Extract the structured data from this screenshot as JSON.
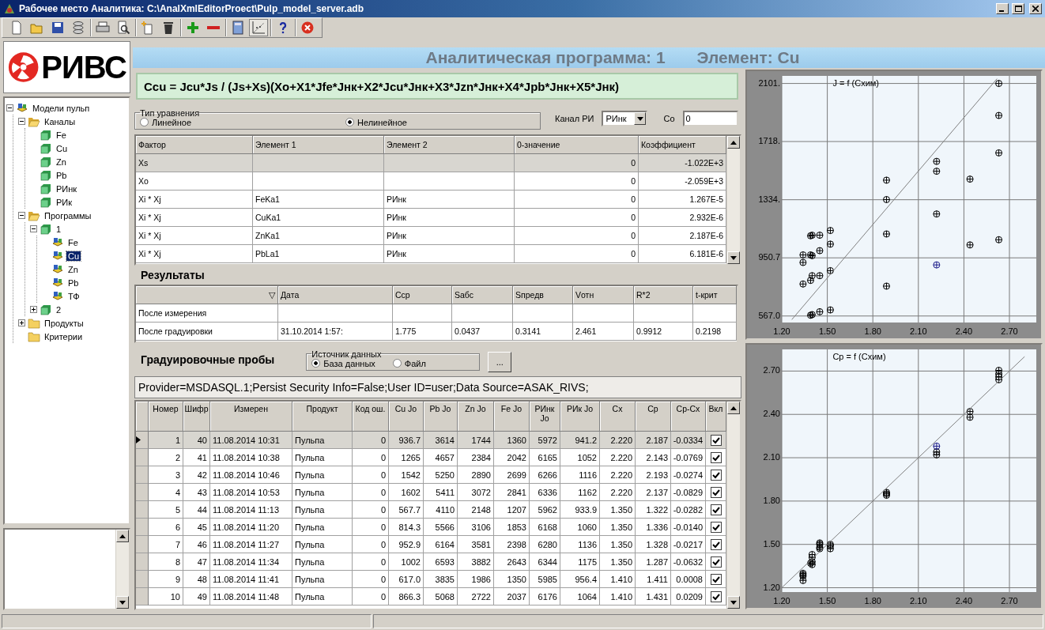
{
  "window": {
    "title": "Рабочее место Аналитика: C:\\AnalXmlEditorProect\\Pulp_model_server.adb"
  },
  "toolbar": [
    [
      {
        "kind": "new",
        "pressed": false
      },
      {
        "kind": "open",
        "pressed": false
      },
      {
        "kind": "save",
        "pressed": false
      },
      {
        "kind": "database",
        "pressed": false
      }
    ],
    [
      {
        "kind": "print",
        "pressed": false
      },
      {
        "kind": "preview",
        "pressed": false
      }
    ],
    [
      {
        "kind": "new-item",
        "pressed": false
      },
      {
        "kind": "delete",
        "pressed": false
      }
    ],
    [
      {
        "kind": "add",
        "pressed": false
      },
      {
        "kind": "remove",
        "pressed": false
      }
    ],
    [
      {
        "kind": "calculator",
        "pressed": false
      },
      {
        "kind": "chart",
        "pressed": true
      }
    ],
    [
      {
        "kind": "help",
        "pressed": false
      }
    ],
    [
      {
        "kind": "stop",
        "pressed": false
      }
    ]
  ],
  "logo": {
    "text": "РИВС"
  },
  "tree": [
    {
      "label": "Модели пульп",
      "kind": "model",
      "expanded": true,
      "selected": false,
      "children": [
        {
          "label": "Каналы",
          "kind": "folder",
          "expanded": true,
          "selected": false,
          "children": [
            {
              "label": "Fe",
              "kind": "channel",
              "selected": false
            },
            {
              "label": "Cu",
              "kind": "channel",
              "selected": false
            },
            {
              "label": "Zn",
              "kind": "channel",
              "selected": false
            },
            {
              "label": "Pb",
              "kind": "channel",
              "selected": false
            },
            {
              "label": "РИнк",
              "kind": "channel",
              "selected": false
            },
            {
              "label": "РИк",
              "kind": "channel",
              "selected": false
            }
          ]
        },
        {
          "label": "Программы",
          "kind": "folder",
          "expanded": true,
          "selected": false,
          "children": [
            {
              "label": "1",
              "kind": "channel",
              "expanded": true,
              "selected": false,
              "children": [
                {
                  "label": "Fe",
                  "kind": "model",
                  "selected": false
                },
                {
                  "label": "Cu",
                  "kind": "model",
                  "selected": true
                },
                {
                  "label": "Zn",
                  "kind": "model",
                  "selected": false
                },
                {
                  "label": "Pb",
                  "kind": "model",
                  "selected": false
                },
                {
                  "label": "ТФ",
                  "kind": "model",
                  "selected": false
                }
              ]
            },
            {
              "label": "2",
              "kind": "channel",
              "expanded": false,
              "selected": false
            }
          ]
        },
        {
          "label": "Продукты",
          "kind": "folder",
          "expanded": false,
          "selected": false
        },
        {
          "label": "Критерии",
          "kind": "folder",
          "selected": false
        }
      ]
    }
  ],
  "header": {
    "program": "Аналитическая программа: 1",
    "element": "Элемент: Cu"
  },
  "formula": "Ccu = Jcu*Js / (Js+Xs)(Xo+X1*Jfe*Jнк+X2*Jcu*Jнк+X3*Jzn*Jнк+X4*Jpb*Jнк+X5*Jнк)",
  "equation_type": {
    "legend": "Тип уравнения",
    "options": [
      {
        "label": "Линейное",
        "selected": false
      },
      {
        "label": "Нелинейное",
        "selected": true
      }
    ]
  },
  "channel": {
    "label": "Канал РИ",
    "value": "РИнк"
  },
  "co": {
    "label": "Co",
    "value": "0"
  },
  "factors": {
    "columns": [
      {
        "label": "Фактор",
        "kind": "text"
      },
      {
        "label": "Элемент 1",
        "kind": "text"
      },
      {
        "label": "Элемент 2",
        "kind": "text"
      },
      {
        "label": "0-значение",
        "kind": "number"
      },
      {
        "label": "Коэффициент",
        "kind": "number"
      }
    ],
    "rows": [
      {
        "cells": [
          "Xs",
          null,
          null,
          "0",
          "-1.022E+3"
        ],
        "selected": true
      },
      {
        "cells": [
          "Xo",
          null,
          null,
          "0",
          "-2.059E+3"
        ],
        "selected": false
      },
      {
        "cells": [
          "Xi * Xj",
          "FeKa1",
          "РИнк",
          "0",
          "1.267E-5"
        ],
        "selected": false
      },
      {
        "cells": [
          "Xi * Xj",
          "CuKa1",
          "РИнк",
          "0",
          "2.932E-6"
        ],
        "selected": false
      },
      {
        "cells": [
          "Xi * Xj",
          "ZnKa1",
          "РИнк",
          "0",
          "2.187E-6"
        ],
        "selected": false
      },
      {
        "cells": [
          "Xi * Xj",
          "PbLa1",
          "РИнк",
          "0",
          "6.181E-6"
        ],
        "selected": false
      }
    ]
  },
  "results": {
    "title": "Результаты",
    "columns": [
      {
        "label": "▽",
        "kind": "sort"
      },
      {
        "label": "Дата",
        "kind": "text"
      },
      {
        "label": "Ccp",
        "kind": "text"
      },
      {
        "label": "Sабс",
        "kind": "text"
      },
      {
        "label": "Sпредв",
        "kind": "text"
      },
      {
        "label": "Vотн",
        "kind": "text"
      },
      {
        "label": "R*2",
        "kind": "text"
      },
      {
        "label": "t-крит",
        "kind": "text"
      }
    ],
    "rows": [
      [
        "После измерения",
        null,
        null,
        null,
        null,
        null,
        null,
        null
      ],
      [
        "После градуировки",
        "31.10.2014 1:57:",
        "1.775",
        "0.0437",
        "0.3141",
        "2.461",
        "0.9912",
        "0.2198"
      ]
    ]
  },
  "calibration": {
    "title": "Градуировочные пробы",
    "source": {
      "legend": "Источник данных",
      "options": [
        {
          "label": "База данных",
          "selected": true
        },
        {
          "label": "Файл",
          "selected": false
        }
      ]
    },
    "browse": "...",
    "connection": "Provider=MSDASQL.1;Persist Security Info=False;User ID=user;Data Source=ASAK_RIVS;"
  },
  "samples": {
    "columns": [
      {
        "label": "Номер",
        "kind": "number"
      },
      {
        "label": "Шифр",
        "kind": "number"
      },
      {
        "label": "Измерен",
        "kind": "text"
      },
      {
        "label": "Продукт",
        "kind": "text"
      },
      {
        "label": "Код ош.",
        "kind": "number"
      },
      {
        "label": "Cu Jo",
        "kind": "number"
      },
      {
        "label": "Pb Jo",
        "kind": "number"
      },
      {
        "label": "Zn Jo",
        "kind": "number"
      },
      {
        "label": "Fe Jo",
        "kind": "number"
      },
      {
        "label": "РИнк Jo",
        "kind": "number"
      },
      {
        "label": "РИк Jo",
        "kind": "number"
      },
      {
        "label": "Cx",
        "kind": "number"
      },
      {
        "label": "Cp",
        "kind": "number"
      },
      {
        "label": "Cp-Cx",
        "kind": "number"
      },
      {
        "label": "Вкл",
        "kind": "check"
      }
    ],
    "rows": [
      {
        "cells": [
          "1",
          "40",
          "11.08.2014 10:31",
          "Пульпа",
          "0",
          "936.7",
          "3614",
          "1744",
          "1360",
          "5972",
          "941.2",
          "2.220",
          "2.187",
          "-0.0334"
        ],
        "included": true,
        "selected": true
      },
      {
        "cells": [
          "2",
          "41",
          "11.08.2014 10:38",
          "Пульпа",
          "0",
          "1265",
          "4657",
          "2384",
          "2042",
          "6165",
          "1052",
          "2.220",
          "2.143",
          "-0.0769"
        ],
        "included": true,
        "selected": false
      },
      {
        "cells": [
          "3",
          "42",
          "11.08.2014 10:46",
          "Пульпа",
          "0",
          "1542",
          "5250",
          "2890",
          "2699",
          "6266",
          "1116",
          "2.220",
          "2.193",
          "-0.0274"
        ],
        "included": true,
        "selected": false
      },
      {
        "cells": [
          "4",
          "43",
          "11.08.2014 10:53",
          "Пульпа",
          "0",
          "1602",
          "5411",
          "3072",
          "2841",
          "6336",
          "1162",
          "2.220",
          "2.137",
          "-0.0829"
        ],
        "included": true,
        "selected": false
      },
      {
        "cells": [
          "5",
          "44",
          "11.08.2014 11:13",
          "Пульпа",
          "0",
          "567.7",
          "4110",
          "2148",
          "1207",
          "5962",
          "933.9",
          "1.350",
          "1.322",
          "-0.0282"
        ],
        "included": true,
        "selected": false
      },
      {
        "cells": [
          "6",
          "45",
          "11.08.2014 11:20",
          "Пульпа",
          "0",
          "814.3",
          "5566",
          "3106",
          "1853",
          "6168",
          "1060",
          "1.350",
          "1.336",
          "-0.0140"
        ],
        "included": true,
        "selected": false
      },
      {
        "cells": [
          "7",
          "46",
          "11.08.2014 11:27",
          "Пульпа",
          "0",
          "952.9",
          "6164",
          "3581",
          "2398",
          "6280",
          "1136",
          "1.350",
          "1.328",
          "-0.0217"
        ],
        "included": true,
        "selected": false
      },
      {
        "cells": [
          "8",
          "47",
          "11.08.2014 11:34",
          "Пульпа",
          "0",
          "1002",
          "6593",
          "3882",
          "2643",
          "6344",
          "1175",
          "1.350",
          "1.287",
          "-0.0632"
        ],
        "included": true,
        "selected": false
      },
      {
        "cells": [
          "9",
          "48",
          "11.08.2014 11:41",
          "Пульпа",
          "0",
          "617.0",
          "3835",
          "1986",
          "1350",
          "5985",
          "956.4",
          "1.410",
          "1.411",
          "0.0008"
        ],
        "included": true,
        "selected": false
      },
      {
        "cells": [
          "10",
          "49",
          "11.08.2014 11:48",
          "Пульпа",
          "0",
          "866.3",
          "5068",
          "2722",
          "2037",
          "6176",
          "1064",
          "1.410",
          "1.431",
          "0.0209"
        ],
        "included": true,
        "selected": false
      }
    ]
  },
  "charts": [
    {
      "chart_data": {
        "type": "scatter",
        "title": "J = f (Схим)",
        "xlim": [
          1.2,
          2.877
        ],
        "ylim": [
          524,
          2151
        ],
        "xticks": [
          {
            "value": 1.2,
            "label": "1.20"
          },
          {
            "value": 1.5,
            "label": "1.50"
          },
          {
            "value": 1.8,
            "label": "1.80"
          },
          {
            "value": 2.1,
            "label": "2.10"
          },
          {
            "value": 2.4,
            "label": "2.40"
          },
          {
            "value": 2.7,
            "label": "2.70"
          }
        ],
        "yticks": [
          {
            "value": 567.0,
            "label": "567.0"
          },
          {
            "value": 950.7,
            "label": "950.7"
          },
          {
            "value": 1334,
            "label": "1334."
          },
          {
            "value": 1718,
            "label": "1718."
          },
          {
            "value": 2101,
            "label": "2101."
          }
        ],
        "series": [
          {
            "color": "#000000",
            "x": [
              2.63,
              2.63,
              2.63,
              2.63,
              2.44,
              2.44,
              2.22,
              2.22,
              2.22,
              1.89,
              1.89,
              1.89,
              1.89,
              1.52,
              1.52,
              1.52,
              1.52,
              1.45,
              1.45,
              1.45,
              1.45,
              1.4,
              1.39,
              1.4,
              1.39,
              1.4,
              1.39,
              1.4,
              1.39,
              1.34,
              1.34,
              1.34
            ],
            "values": [
              2101,
              1890,
              1643,
              1070,
              1470,
              1036,
              1587,
              1522,
              1240,
              1463,
              1335,
              1108,
              764,
              1131,
              1041,
              866,
              607,
              1100,
              998,
              833,
              595,
              1100,
              1096,
              965,
              970,
              833,
              802,
              576,
              572,
              970,
              920,
              778
            ]
          },
          {
            "color": "#1c1c8a",
            "x": [
              2.22
            ],
            "values": [
              904
            ]
          },
          {
            "type": "line",
            "color": "#808080",
            "x": [
              1.266,
              2.618
            ],
            "values": [
              543,
              2132
            ]
          }
        ],
        "grid": true
      }
    },
    {
      "chart_data": {
        "type": "scatter",
        "title": "Cp = f (Схим)",
        "xlim": [
          1.2,
          2.877
        ],
        "ylim": [
          1.17,
          2.85
        ],
        "xticks": [
          {
            "value": 1.2,
            "label": "1.20"
          },
          {
            "value": 1.5,
            "label": "1.50"
          },
          {
            "value": 1.8,
            "label": "1.80"
          },
          {
            "value": 2.1,
            "label": "2.10"
          },
          {
            "value": 2.4,
            "label": "2.40"
          },
          {
            "value": 2.7,
            "label": "2.70"
          }
        ],
        "yticks": [
          {
            "value": 1.2,
            "label": "1.20"
          },
          {
            "value": 1.5,
            "label": "1.50"
          },
          {
            "value": 1.8,
            "label": "1.80"
          },
          {
            "value": 2.1,
            "label": "2.10"
          },
          {
            "value": 2.4,
            "label": "2.40"
          },
          {
            "value": 2.7,
            "label": "2.70"
          }
        ],
        "series": [
          {
            "color": "#000000",
            "x": [
              2.63,
              2.63,
              2.63,
              2.63,
              2.44,
              2.44,
              2.22,
              2.22,
              1.89,
              1.89,
              1.89,
              1.52,
              1.52,
              1.52,
              1.45,
              1.45,
              1.45,
              1.45,
              1.4,
              1.4,
              1.4,
              1.4,
              1.39,
              1.34,
              1.34,
              1.34,
              1.34
            ],
            "values": [
              2.705,
              2.68,
              2.66,
              2.64,
              2.42,
              2.38,
              2.14,
              2.12,
              1.86,
              1.85,
              1.84,
              1.5,
              1.49,
              1.47,
              1.51,
              1.5,
              1.48,
              1.47,
              1.43,
              1.41,
              1.38,
              1.36,
              1.37,
              1.3,
              1.29,
              1.28,
              1.25
            ]
          },
          {
            "color": "#1c1c8a",
            "x": [
              2.22
            ],
            "values": [
              2.18
            ]
          },
          {
            "type": "line",
            "color": "#808080",
            "x": [
              1.2,
              2.8
            ],
            "values": [
              1.2,
              2.8
            ]
          }
        ],
        "grid": true
      }
    }
  ]
}
